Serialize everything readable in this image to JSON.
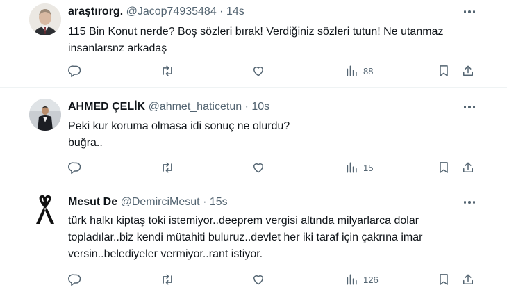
{
  "tweets": [
    {
      "display_name": "araştırorg.",
      "handle": "@Jacop74935484",
      "separator": "·",
      "time": "14s",
      "text": "115 Bin Konut nerde? Boş sözleri bırak! Verdiğiniz sözleri tutun! Ne utanmaz\ninsanlarsnz arkadaş",
      "views": "88"
    },
    {
      "display_name": "AHMED ÇELİK",
      "handle": "@ahmet_haticetun",
      "separator": "·",
      "time": "10s",
      "text": "Peki kur koruma olmasa idi sonuç ne olurdu?\nbuğra..",
      "views": "15"
    },
    {
      "display_name": "Mesut De",
      "handle": "@DemirciMesut",
      "separator": "·",
      "time": "15s",
      "text": "türk halkı kiptaş toki istemiyor..deeprem vergisi altında milyarlarca dolar\ntopladılar..biz kendi mütahiti buluruz..devlet her iki taraf için çakrına imar\nversin..belediyeler vermiyor..rant istiyor.",
      "views": "126"
    }
  ],
  "icons": {
    "reply": "reply-icon",
    "retweet": "retweet-icon",
    "like": "like-icon",
    "views": "views-icon",
    "bookmark": "bookmark-icon",
    "share": "share-icon",
    "more": "more-icon"
  },
  "colors": {
    "text": "#0f1419",
    "secondary": "#536471",
    "divider": "#eff3f4"
  }
}
